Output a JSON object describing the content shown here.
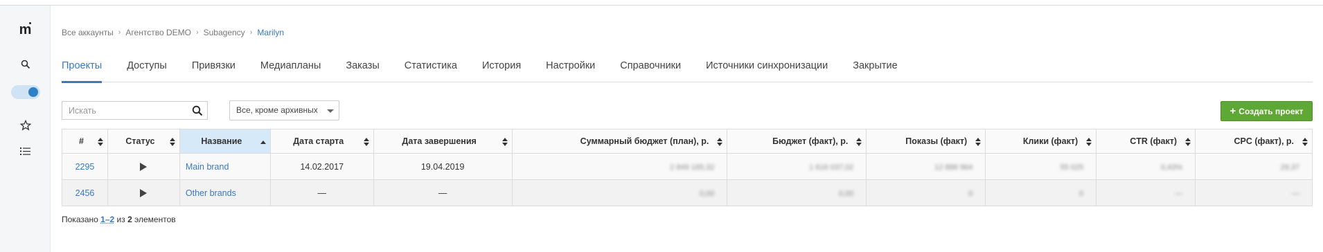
{
  "sidebar": {
    "logo": "m",
    "toggle_on": true
  },
  "breadcrumb": [
    "Все аккаунты",
    "Агентство DEMO",
    "Subagency",
    "Marilyn"
  ],
  "tabs": [
    {
      "label": "Проекты",
      "active": true
    },
    {
      "label": "Доступы"
    },
    {
      "label": "Привязки"
    },
    {
      "label": "Медиапланы"
    },
    {
      "label": "Заказы"
    },
    {
      "label": "Статистика"
    },
    {
      "label": "История"
    },
    {
      "label": "Настройки"
    },
    {
      "label": "Справочники"
    },
    {
      "label": "Источники синхронизации"
    },
    {
      "label": "Закрытие"
    }
  ],
  "search": {
    "placeholder": "Искать"
  },
  "filter": {
    "selected": "Все, кроме архивных"
  },
  "create_button": {
    "label": "Создать проект",
    "color": "#5ea936"
  },
  "table": {
    "columns": [
      "#",
      "Статус",
      "Название",
      "Дата старта",
      "Дата завершения",
      "Суммарный бюджет (план), р.",
      "Бюджет (факт), р.",
      "Показы (факт)",
      "Клики (факт)",
      "CTR (факт)",
      "CPC (факт), р."
    ],
    "sorted_column": "Название",
    "rows": [
      {
        "id": "2295",
        "status": "play",
        "name": "Main brand",
        "start": "14.02.2017",
        "end": "19.04.2019",
        "budget_plan": "2 849 185,32",
        "budget_fact": "1 616 037,02",
        "impressions": "12 888 964",
        "clicks": "55 025",
        "ctr": "0,43%",
        "cpc": "29,37"
      },
      {
        "id": "2456",
        "status": "play",
        "name": "Other brands",
        "start": "—",
        "end": "—",
        "budget_plan": "0,00",
        "budget_fact": "0,00",
        "impressions": "0",
        "clicks": "0",
        "ctr": "—",
        "cpc": "—"
      }
    ]
  },
  "summary": {
    "prefix": "Показано",
    "range": "1–2",
    "middle": "из",
    "total": "2",
    "suffix": "элементов"
  },
  "colors": {
    "accent": "#3a78c3",
    "success": "#5ea936"
  }
}
